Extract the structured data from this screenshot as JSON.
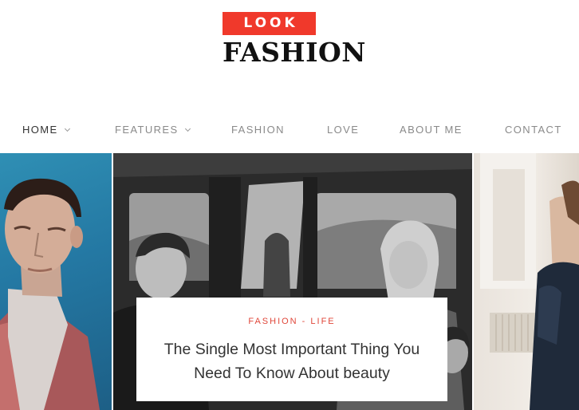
{
  "logo": {
    "look": "LOOK",
    "fashion": "FASHION"
  },
  "nav": {
    "items": [
      {
        "label": "HOME",
        "has_dropdown": true,
        "active": true
      },
      {
        "label": "FEATURES",
        "has_dropdown": true,
        "active": false
      },
      {
        "label": "FASHION",
        "has_dropdown": false,
        "active": false
      },
      {
        "label": "LOVE",
        "has_dropdown": false,
        "active": false
      },
      {
        "label": "ABOUT ME",
        "has_dropdown": false,
        "active": false
      },
      {
        "label": "CONTACT",
        "has_dropdown": false,
        "active": false
      }
    ]
  },
  "featured": {
    "categories": "FASHION - LIFE",
    "title": "The Single Most Important Thing You Need To Know About beauty"
  },
  "colors": {
    "accent": "#f0392b",
    "category_text": "#e0473a"
  }
}
